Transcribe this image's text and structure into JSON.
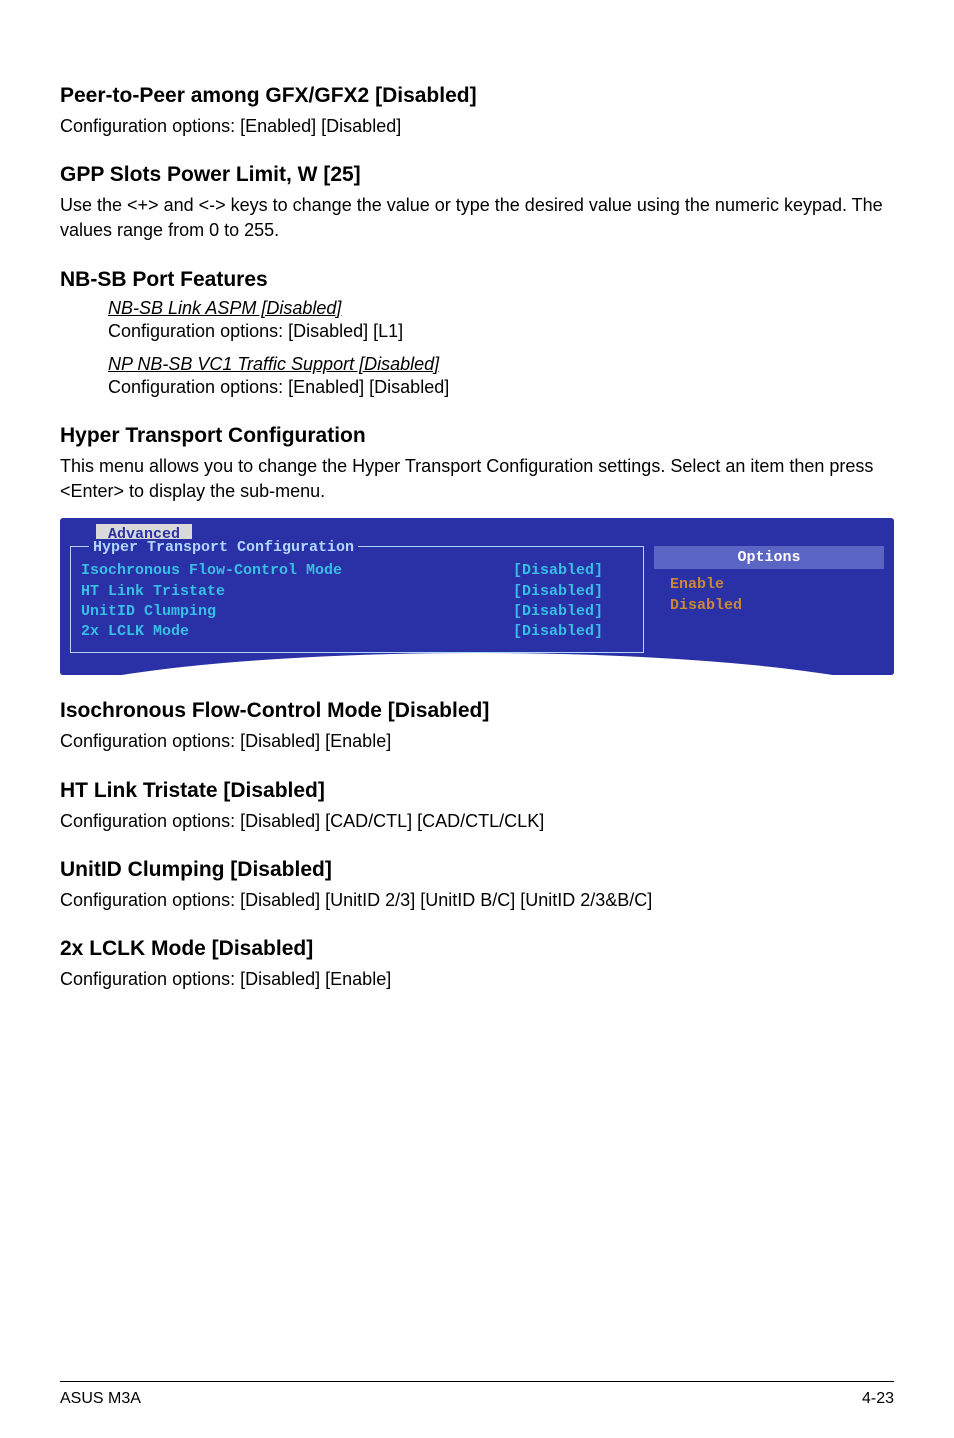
{
  "sections": {
    "p2p": {
      "heading": "Peer-to-Peer among GFX/GFX2 [Disabled]",
      "body": "Configuration options: [Enabled] [Disabled]"
    },
    "gpp": {
      "heading": "GPP Slots Power Limit, W [25]",
      "body": "Use the <+> and <-> keys to change the value or type the desired value using the numeric keypad. The values range from 0 to 255."
    },
    "nbsb": {
      "heading": "NB-SB Port Features",
      "sub1_heading": "NB-SB Link ASPM [Disabled]",
      "sub1_body": "Configuration options: [Disabled] [L1]",
      "sub2_heading": "NP NB-SB VC1 Traffic Support [Disabled]",
      "sub2_body": "Configuration options: [Enabled] [Disabled]"
    },
    "hyper": {
      "heading": "Hyper Transport Configuration",
      "body": "This menu allows you to change the Hyper Transport Configuration settings. Select an item then press <Enter> to display the sub-menu."
    },
    "iso": {
      "heading": "Isochronous Flow-Control Mode [Disabled]",
      "body": "Configuration options: [Disabled] [Enable]"
    },
    "htlink": {
      "heading": "HT Link Tristate [Disabled]",
      "body": "Configuration options: [Disabled] [CAD/CTL] [CAD/CTL/CLK]"
    },
    "unitid": {
      "heading": "UnitID Clumping [Disabled]",
      "body": "Configuration options: [Disabled] [UnitID 2/3] [UnitID B/C] [UnitID 2/3&B/C]"
    },
    "lclk": {
      "heading": "2x LCLK Mode [Disabled]",
      "body": "Configuration options: [Disabled] [Enable]"
    }
  },
  "bios": {
    "tab": "Advanced",
    "panel_title": "Hyper Transport Configuration",
    "rows": [
      {
        "label": "Isochronous Flow-Control Mode",
        "value": "[Disabled]"
      },
      {
        "label": "HT Link Tristate",
        "value": "[Disabled]"
      },
      {
        "label": "UnitID Clumping",
        "value": "[Disabled]"
      },
      {
        "label": "2x LCLK Mode",
        "value": "[Disabled]"
      }
    ],
    "options_header": "Options",
    "options": [
      "Enable",
      "Disabled"
    ]
  },
  "footer": {
    "left": "ASUS M3A",
    "right": "4-23"
  }
}
